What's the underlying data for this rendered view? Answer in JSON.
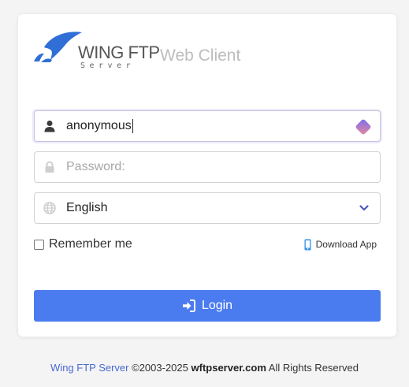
{
  "logo": {
    "wordmark": "WING FTP",
    "sub": "Server",
    "app_label": "Web Client"
  },
  "form": {
    "username": {
      "value": "anonymous",
      "icon": "user-icon"
    },
    "password": {
      "placeholder": "Password:",
      "icon": "lock-icon"
    },
    "language": {
      "selected": "English",
      "icon": "globe-icon"
    },
    "remember_label": "Remember me",
    "download_label": "Download App",
    "login_label": "Login"
  },
  "footer": {
    "brand": "Wing FTP Server",
    "copyright": "©2003-2025",
    "site": "wftpserver.com",
    "rights": "All Rights Reserved"
  },
  "colors": {
    "primary": "#4a7bef",
    "link": "#4a68d2",
    "logo_blue": "#2f6fd6",
    "page_bg": "#f4f4f4"
  }
}
